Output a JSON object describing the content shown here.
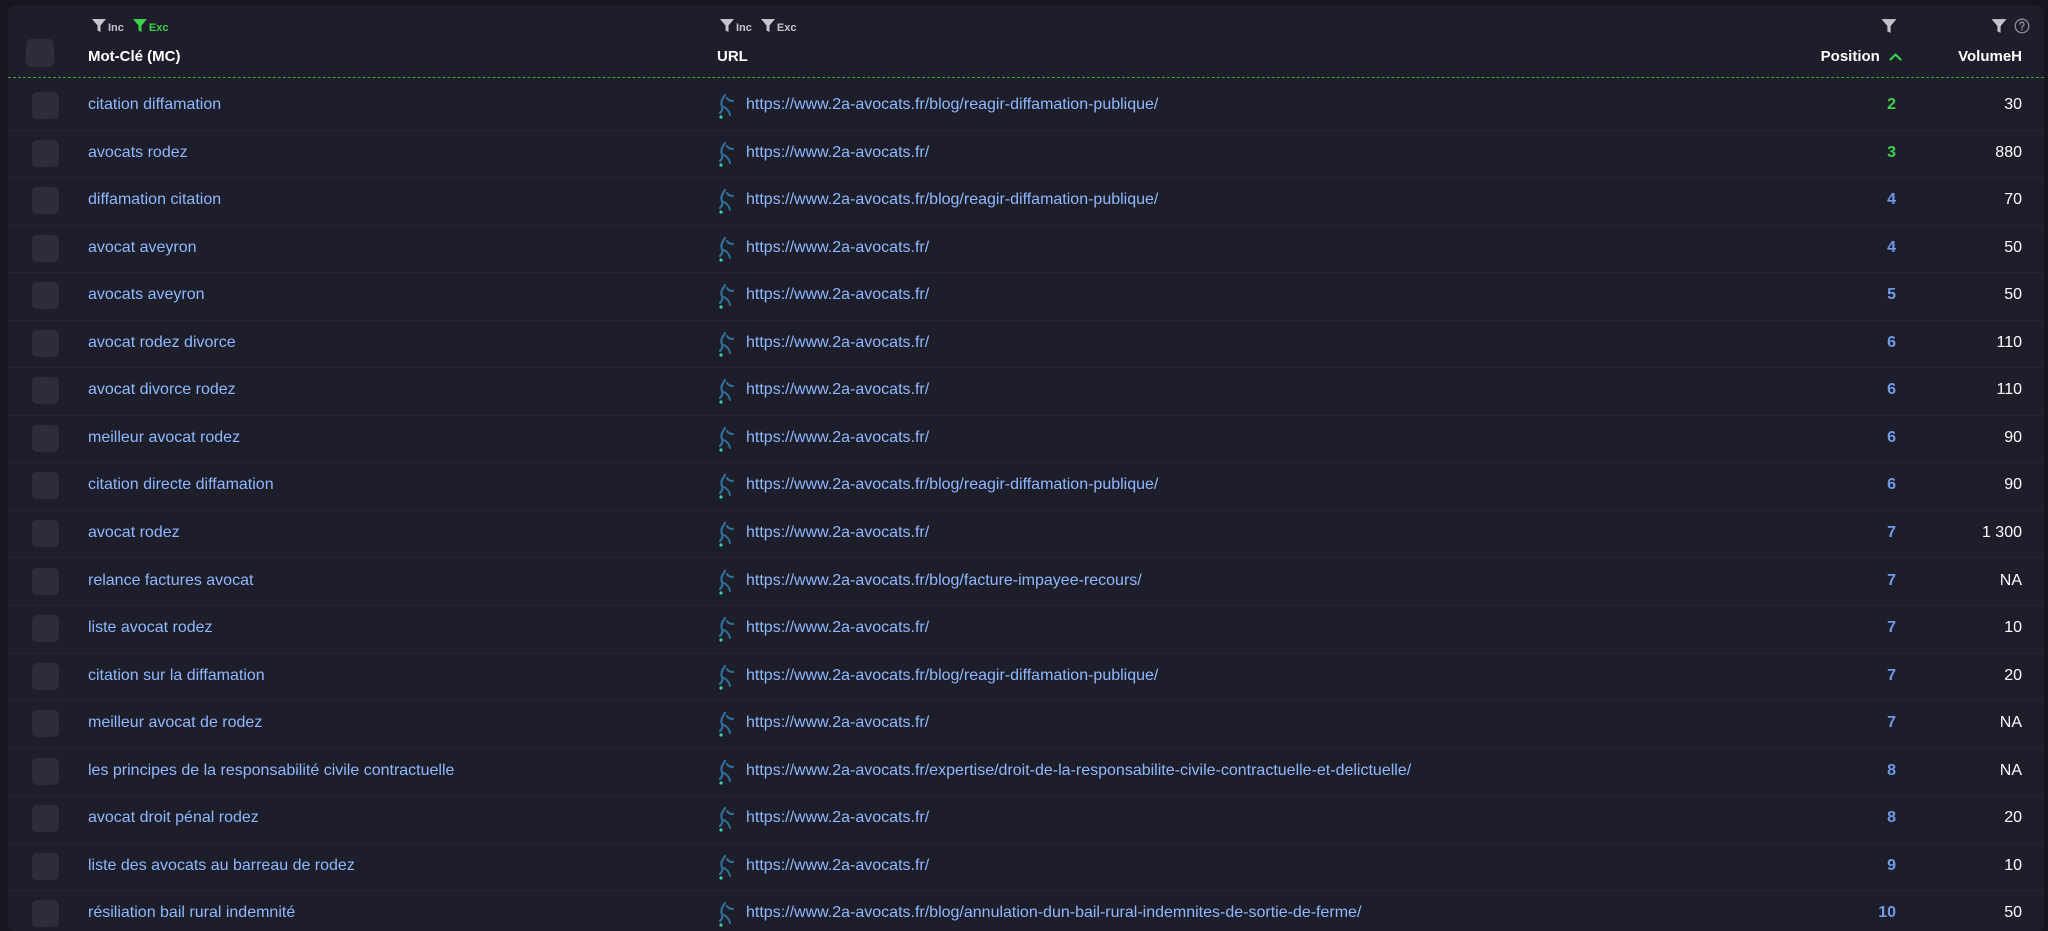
{
  "header": {
    "keyword": {
      "title": "Mot-Clé (MC)",
      "inc": "Inc",
      "exc": "Exc"
    },
    "url": {
      "title": "URL",
      "inc": "Inc",
      "exc": "Exc"
    },
    "position": {
      "title": "Position"
    },
    "volume": {
      "title": "VolumeH"
    }
  },
  "colors": {
    "background": "#1e1e2a",
    "link": "#8eb8ff",
    "position_top": "#3bd14b",
    "position": "#6f9be8",
    "active_filter": "#3bd14b"
  },
  "rows": [
    {
      "keyword": "citation diffamation",
      "url": "https://www.2a-avocats.fr/blog/reagir-diffamation-publique/",
      "position": "2",
      "volume": "30"
    },
    {
      "keyword": "avocats rodez",
      "url": "https://www.2a-avocats.fr/",
      "position": "3",
      "volume": "880"
    },
    {
      "keyword": "diffamation citation",
      "url": "https://www.2a-avocats.fr/blog/reagir-diffamation-publique/",
      "position": "4",
      "volume": "70"
    },
    {
      "keyword": "avocat aveyron",
      "url": "https://www.2a-avocats.fr/",
      "position": "4",
      "volume": "50"
    },
    {
      "keyword": "avocats aveyron",
      "url": "https://www.2a-avocats.fr/",
      "position": "5",
      "volume": "50"
    },
    {
      "keyword": "avocat rodez divorce",
      "url": "https://www.2a-avocats.fr/",
      "position": "6",
      "volume": "110"
    },
    {
      "keyword": "avocat divorce rodez",
      "url": "https://www.2a-avocats.fr/",
      "position": "6",
      "volume": "110"
    },
    {
      "keyword": "meilleur avocat rodez",
      "url": "https://www.2a-avocats.fr/",
      "position": "6",
      "volume": "90"
    },
    {
      "keyword": "citation directe diffamation",
      "url": "https://www.2a-avocats.fr/blog/reagir-diffamation-publique/",
      "position": "6",
      "volume": "90"
    },
    {
      "keyword": "avocat rodez",
      "url": "https://www.2a-avocats.fr/",
      "position": "7",
      "volume": "1 300"
    },
    {
      "keyword": "relance factures avocat",
      "url": "https://www.2a-avocats.fr/blog/facture-impayee-recours/",
      "position": "7",
      "volume": "NA"
    },
    {
      "keyword": "liste avocat rodez",
      "url": "https://www.2a-avocats.fr/",
      "position": "7",
      "volume": "10"
    },
    {
      "keyword": "citation sur la diffamation",
      "url": "https://www.2a-avocats.fr/blog/reagir-diffamation-publique/",
      "position": "7",
      "volume": "20"
    },
    {
      "keyword": "meilleur avocat de rodez",
      "url": "https://www.2a-avocats.fr/",
      "position": "7",
      "volume": "NA"
    },
    {
      "keyword": "les principes de la responsabilité civile contractuelle",
      "url": "https://www.2a-avocats.fr/expertise/droit-de-la-responsabilite-civile-contractuelle-et-delictuelle/",
      "position": "8",
      "volume": "NA"
    },
    {
      "keyword": "avocat droit pénal rodez",
      "url": "https://www.2a-avocats.fr/",
      "position": "8",
      "volume": "20"
    },
    {
      "keyword": "liste des avocats au barreau de rodez",
      "url": "https://www.2a-avocats.fr/",
      "position": "9",
      "volume": "10"
    },
    {
      "keyword": "résiliation bail rural indemnité",
      "url": "https://www.2a-avocats.fr/blog/annulation-dun-bail-rural-indemnites-de-sortie-de-ferme/",
      "position": "10",
      "volume": "50"
    }
  ]
}
